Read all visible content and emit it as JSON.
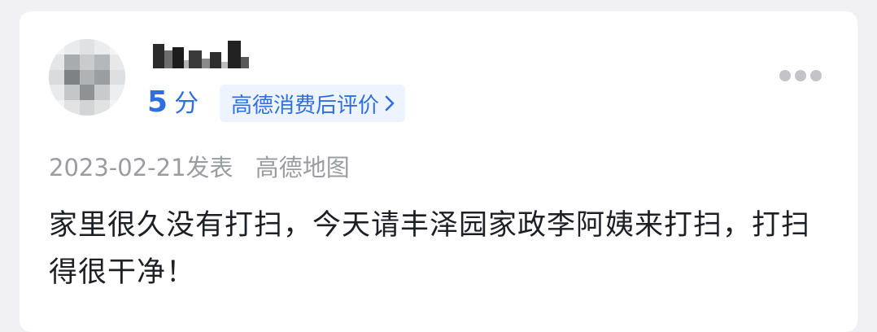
{
  "review": {
    "score_value": "5",
    "score_unit": "分",
    "tag_label": "高德消费后评价",
    "date": "2023-02-21发表",
    "source": "高德地图",
    "content": "家里很久没有打扫，今天请丰泽园家政李阿姨来打扫，打扫得很干净！"
  },
  "icons": {
    "tag_chevron": "chevron-right-icon",
    "more": "more-dots-icon"
  },
  "colors": {
    "accent": "#2f6fe0",
    "tag_bg": "#eef4ff",
    "meta_text": "#9a9ca1",
    "body_text": "#1d1f24"
  }
}
